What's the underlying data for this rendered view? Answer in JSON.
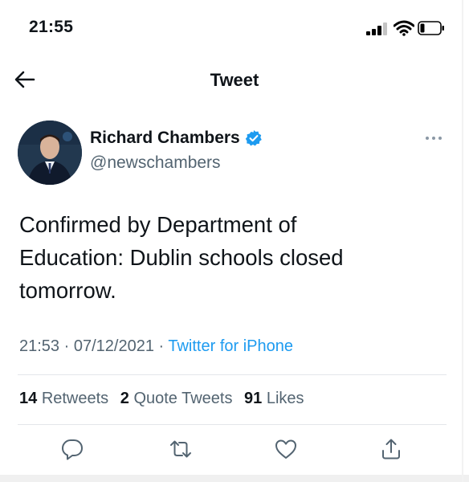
{
  "status_bar": {
    "time": "21:55",
    "icons": [
      "cellular-signal-icon",
      "wifi-icon",
      "battery-icon"
    ]
  },
  "nav": {
    "title": "Tweet",
    "back_icon": "arrow-left-icon"
  },
  "tweet": {
    "author": {
      "name": "Richard Chambers",
      "handle": "@newschambers",
      "verified": true,
      "avatar_icon": "profile-photo"
    },
    "text_lines": [
      "Confirmed by Department of",
      "Education: Dublin schools closed",
      "tomorrow."
    ],
    "time": "21:53",
    "sep1": " · ",
    "date": "07/12/2021",
    "sep2": " · ",
    "source": "Twitter for iPhone"
  },
  "stats": [
    {
      "count": "14",
      "label": "Retweets"
    },
    {
      "count": "2",
      "label": "Quote Tweets"
    },
    {
      "count": "91",
      "label": "Likes"
    }
  ],
  "actions": [
    "reply-icon",
    "retweet-icon",
    "like-icon",
    "share-icon"
  ],
  "colors": {
    "accent": "#1d9bf0",
    "secondary_text": "#536471",
    "primary_text": "#0f1419",
    "divider": "#e3e6ea"
  }
}
